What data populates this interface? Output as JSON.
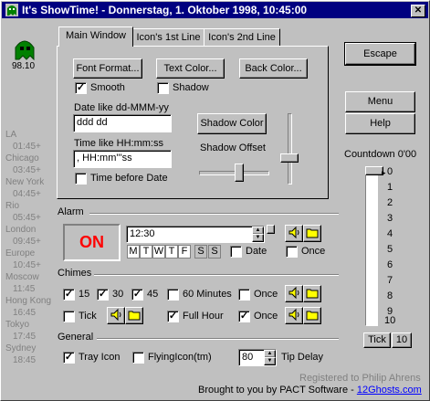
{
  "window": {
    "title": "It's ShowTime! - Donnerstag, 1. Oktober 1998, 10:45:00"
  },
  "left": {
    "version": "98.10",
    "clocks": [
      {
        "city": "LA",
        "time": "01:45+"
      },
      {
        "city": "Chicago",
        "time": "03:45+"
      },
      {
        "city": "New York",
        "time": "04:45+"
      },
      {
        "city": "Rio",
        "time": "05:45+"
      },
      {
        "city": "London",
        "time": "09:45+"
      },
      {
        "city": "Europe",
        "time": "10:45+"
      },
      {
        "city": "Moscow",
        "time": "11:45"
      },
      {
        "city": "Hong Kong",
        "time": "16:45"
      },
      {
        "city": "Tokyo",
        "time": "17:45"
      },
      {
        "city": "Sydney",
        "time": "18:45"
      }
    ]
  },
  "tabs": {
    "main": "Main Window",
    "line1": "Icon's 1st Line",
    "line2": "Icon's 2nd Line"
  },
  "main": {
    "font_format": "Font Format...",
    "text_color": "Text Color...",
    "back_color": "Back Color...",
    "smooth": "Smooth",
    "shadow": "Shadow",
    "date_label": "Date like dd-MMM-yy",
    "date_value": "ddd dd",
    "time_label": "Time like HH:mm:ss",
    "time_value": ", HH:mm'''ss",
    "shadow_color": "Shadow Color",
    "shadow_offset": "Shadow Offset",
    "time_before_date": "Time before Date"
  },
  "alarm": {
    "label": "Alarm",
    "status": "ON",
    "time": "12:30",
    "days": [
      "M",
      "T",
      "W",
      "T",
      "F",
      "S",
      "S"
    ],
    "date": "Date",
    "once": "Once"
  },
  "chimes": {
    "label": "Chimes",
    "m15": "15",
    "m30": "30",
    "m45": "45",
    "m60": "60 Minutes",
    "once1": "Once",
    "tick": "Tick",
    "full_hour": "Full Hour",
    "once2": "Once"
  },
  "general": {
    "label": "General",
    "tray_icon": "Tray Icon",
    "flying_icon": "FlyingIcon(tm)",
    "tip_delay_value": "80",
    "tip_delay": "Tip Delay"
  },
  "right": {
    "escape": "Escape",
    "menu": "Menu",
    "help": "Help",
    "countdown_title": "Countdown 0'00",
    "scale": [
      "0",
      "1",
      "2",
      "3",
      "4",
      "5",
      "6",
      "7",
      "8",
      "9",
      "10"
    ],
    "tick": "Tick",
    "tick_value": "10"
  },
  "footer": {
    "registered": "Registered to Philip Ahrens",
    "brought": "Brought to you by PACT Software - ",
    "link": "12Ghosts.com"
  },
  "colors": {
    "title_bar": "#000080",
    "alarm_on": "#ff0000",
    "ghost": "#008000",
    "link": "#0000ff"
  }
}
